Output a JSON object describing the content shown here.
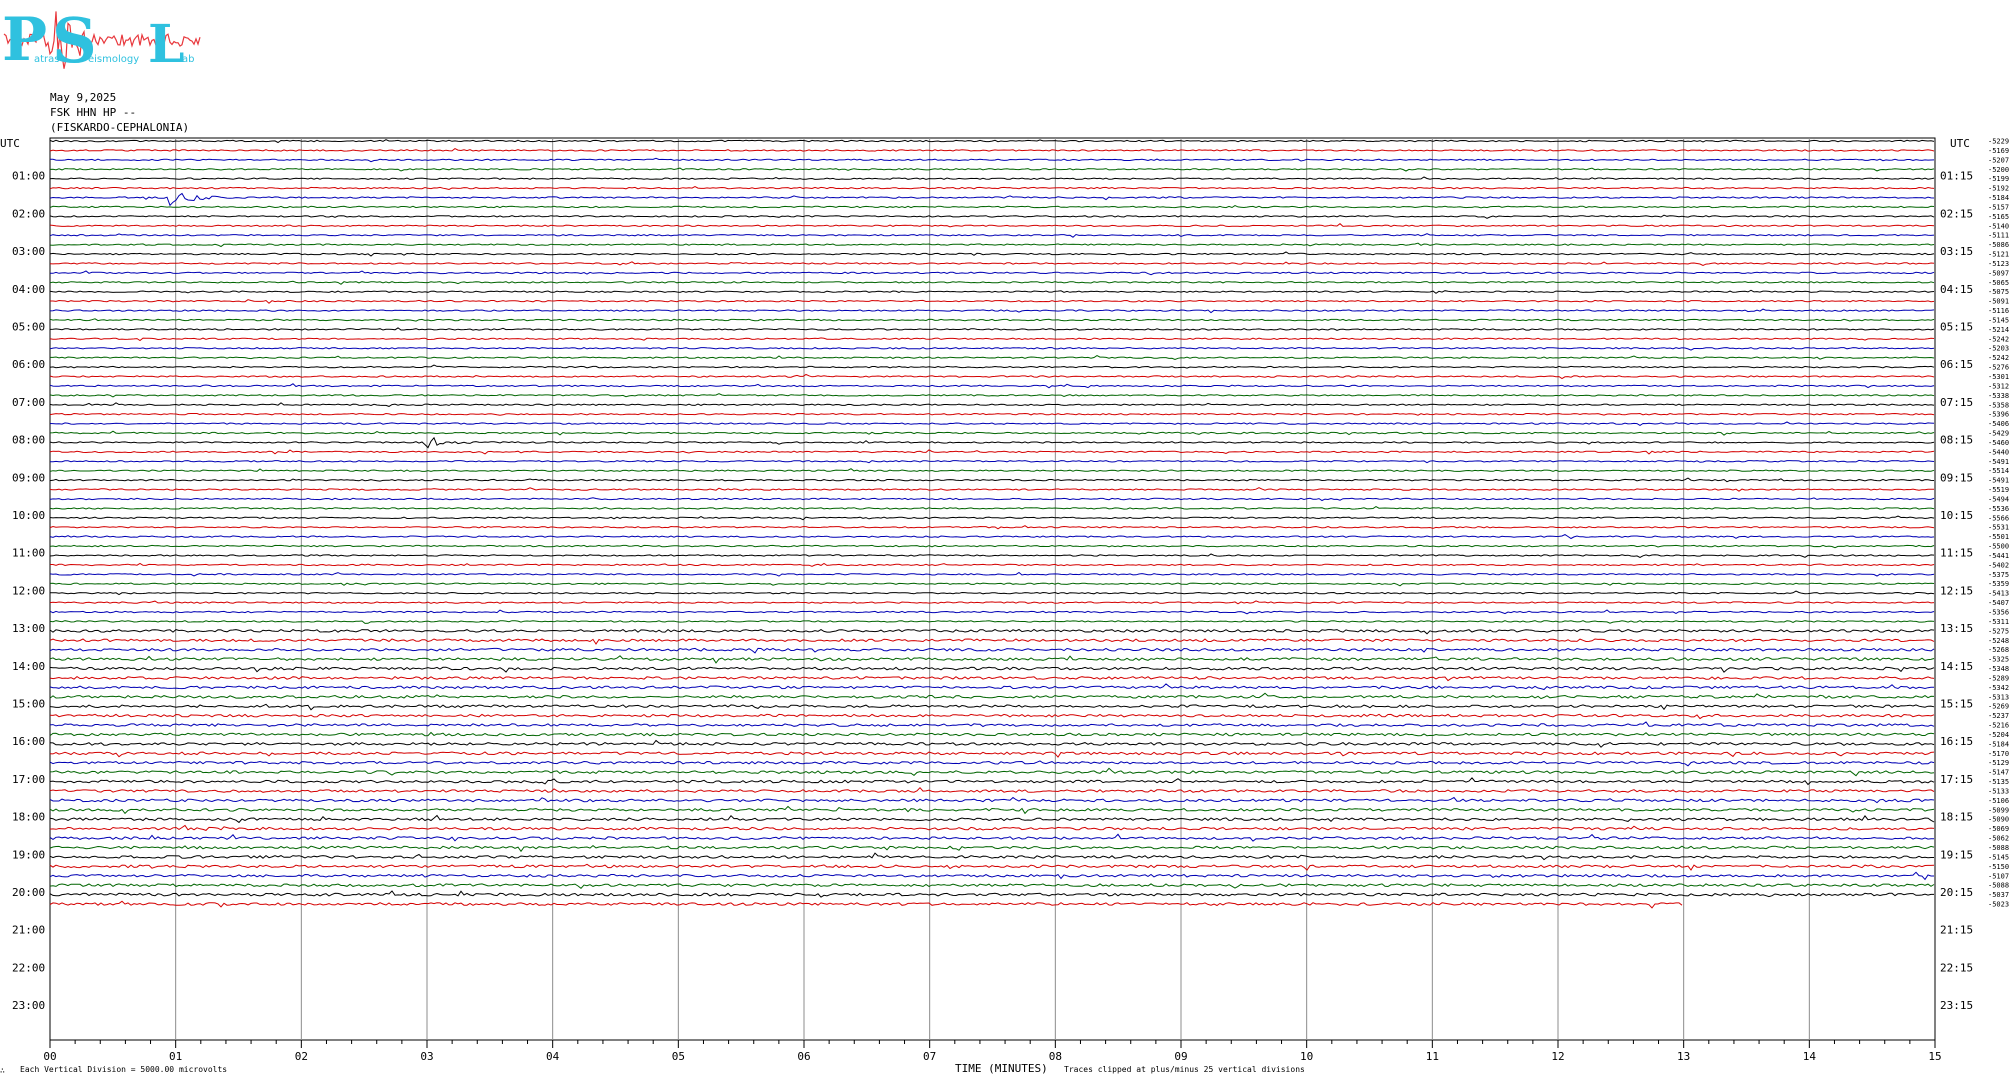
{
  "logo": {
    "letters": [
      "P",
      "S",
      "L"
    ],
    "words": [
      "atras",
      "eismology",
      "ab"
    ],
    "color": "#2fc1df",
    "wave_color": "#e8383d"
  },
  "header": {
    "date": "May 9,2025",
    "station": "FSK HHN HP --",
    "location": "(FISKARDO-CEPHALONIA)"
  },
  "footer": {
    "left_symbol": "∴",
    "scale_note": "Each Vertical Division = 5000.00 microvolts",
    "xlabel": "TIME (MINUTES)",
    "clip_note": "Traces clipped at plus/minus 25 vertical divisions"
  },
  "chart_data": {
    "type": "line",
    "title": "",
    "xlabel": "TIME (MINUTES)",
    "x_ticks": [
      "00",
      "01",
      "02",
      "03",
      "04",
      "05",
      "06",
      "07",
      "08",
      "09",
      "10",
      "11",
      "12",
      "13",
      "14",
      "15"
    ],
    "xlim": [
      0,
      15
    ],
    "utc_label": "UTC",
    "left_hours": [
      "01:00",
      "02:00",
      "03:00",
      "04:00",
      "05:00",
      "06:00",
      "07:00",
      "08:00",
      "09:00",
      "10:00",
      "11:00",
      "12:00",
      "13:00",
      "14:00",
      "15:00",
      "16:00",
      "17:00",
      "18:00",
      "19:00",
      "20:00",
      "21:00",
      "22:00",
      "23:00"
    ],
    "right_hours": [
      "01:15",
      "02:15",
      "03:15",
      "04:15",
      "05:15",
      "06:15",
      "07:15",
      "08:15",
      "09:15",
      "10:15",
      "11:15",
      "12:15",
      "13:15",
      "14:15",
      "15:15",
      "16:15",
      "17:15",
      "18:15",
      "19:15",
      "20:15",
      "21:15",
      "22:15",
      "23:15"
    ],
    "trace_colors": [
      "#000000",
      "#d40000",
      "#0000b4",
      "#006400"
    ],
    "trace_count": 82,
    "last_trace_end_minute": 13,
    "offsets": [
      "-5229",
      "-5169",
      "-5207",
      "-5200",
      "-5199",
      "-5192",
      "-5184",
      "-5157",
      "-5165",
      "-5140",
      "-5111",
      "-5086",
      "-5121",
      "-5123",
      "-5097",
      "-5065",
      "-5075",
      "-5091",
      "-5116",
      "-5145",
      "-5214",
      "-5242",
      "-5203",
      "-5242",
      "-5276",
      "-5301",
      "-5312",
      "-5338",
      "-5358",
      "-5396",
      "-5406",
      "-5429",
      "-5460",
      "-5440",
      "-5491",
      "-5514",
      "-5491",
      "-5519",
      "-5494",
      "-5536",
      "-5566",
      "-5531",
      "-5501",
      "-5500",
      "-5441",
      "-5402",
      "-5375",
      "-5359",
      "-5413",
      "-5407",
      "-5356",
      "-5311",
      "-5275",
      "-5248",
      "-5268",
      "-5325",
      "-5348",
      "-5289",
      "-5342",
      "-5313",
      "-5269",
      "-5237",
      "-5216",
      "-5204",
      "-5184",
      "-5170",
      "-5129",
      "-5147",
      "-5135",
      "-5133",
      "-5106",
      "-5099",
      "-5090",
      "-5069",
      "-5062",
      "-5088",
      "-5145",
      "-5150",
      "-5107",
      "-5088",
      "-5037",
      "-5023"
    ],
    "events": [
      {
        "trace": 6,
        "minute": 0.97,
        "amplitude": 9
      },
      {
        "trace": 32,
        "minute": 3.0,
        "amplitude": 6
      }
    ]
  }
}
